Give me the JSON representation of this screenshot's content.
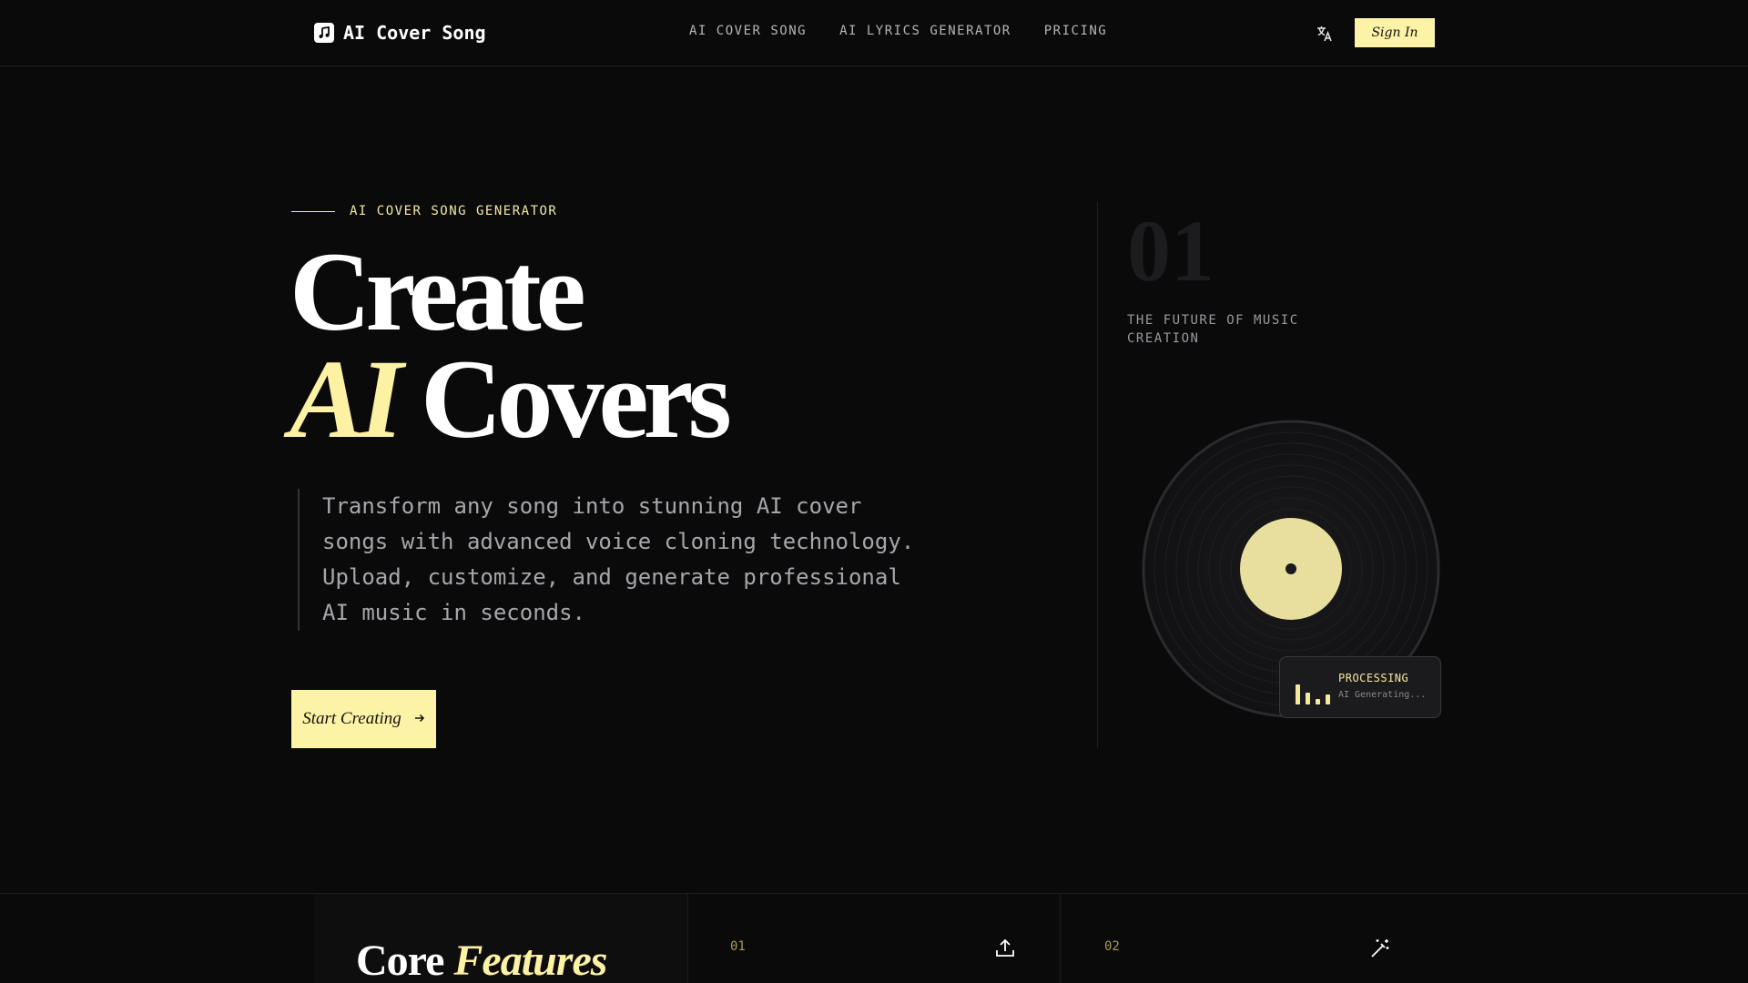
{
  "header": {
    "logo_text": "AI Cover Song",
    "nav": [
      "AI COVER SONG",
      "AI LYRICS GENERATOR",
      "PRICING"
    ],
    "signin_label": "Sign In"
  },
  "hero": {
    "eyebrow": "AI COVER SONG GENERATOR",
    "title_line1": "Create",
    "title_accent": "AI",
    "title_line2_rest": "Covers",
    "description": "Transform any song into stunning AI cover songs with advanced voice cloning technology. Upload, customize, and generate professional AI music in seconds.",
    "cta_label": "Start Creating"
  },
  "side": {
    "number": "01",
    "caption": "THE FUTURE OF MUSIC CREATION",
    "status_title": "PROCESSING",
    "status_sub": "AI Generating..."
  },
  "features": {
    "title_plain": "Core",
    "title_accent": "Features",
    "cards": [
      {
        "num": "01",
        "icon": "upload-icon"
      },
      {
        "num": "02",
        "icon": "magic-wand-icon"
      }
    ]
  },
  "colors": {
    "background": "#0a0a0b",
    "accent": "#fdf3a7",
    "muted_text": "#a7a7ab"
  }
}
